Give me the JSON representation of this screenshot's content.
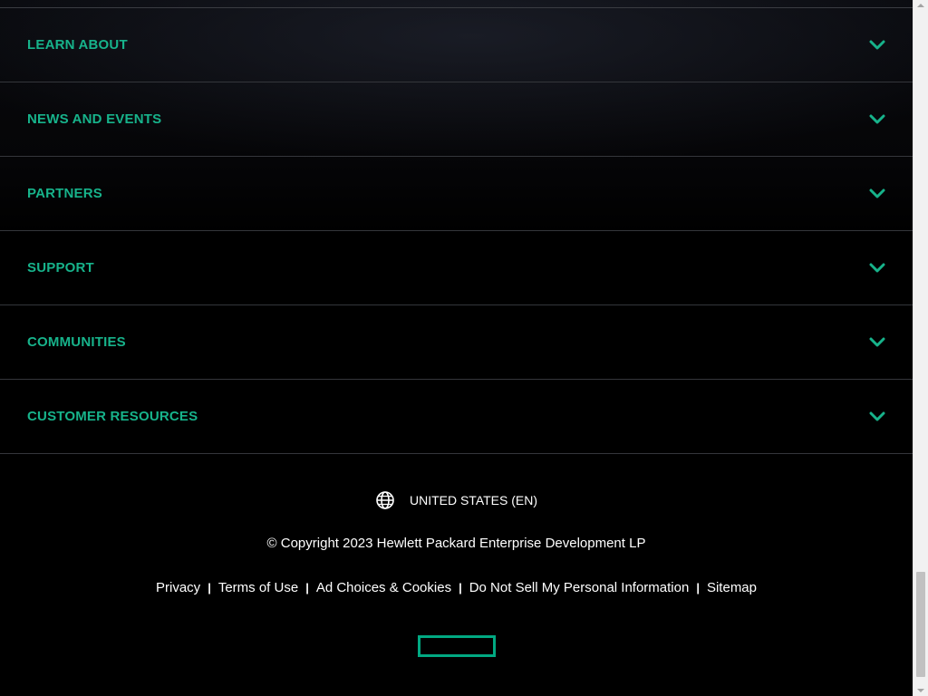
{
  "accordion": {
    "items": [
      {
        "label": "LEARN ABOUT"
      },
      {
        "label": "NEWS AND EVENTS"
      },
      {
        "label": "PARTNERS"
      },
      {
        "label": "SUPPORT"
      },
      {
        "label": "COMMUNITIES"
      },
      {
        "label": "CUSTOMER RESOURCES"
      }
    ],
    "accent_color": "#17b38b",
    "chevron_icon": "chevron-down-icon"
  },
  "footer": {
    "locale": "UNITED STATES (EN)",
    "locale_icon": "globe-icon",
    "copyright": "© Copyright 2023 Hewlett Packard Enterprise Development LP",
    "links": {
      "privacy": "Privacy",
      "terms": "Terms of Use",
      "ad_choices": "Ad Choices & Cookies",
      "do_not_sell": "Do Not Sell My Personal Information",
      "sitemap": "Sitemap"
    },
    "separator": "|",
    "logo_color": "#01a982"
  }
}
